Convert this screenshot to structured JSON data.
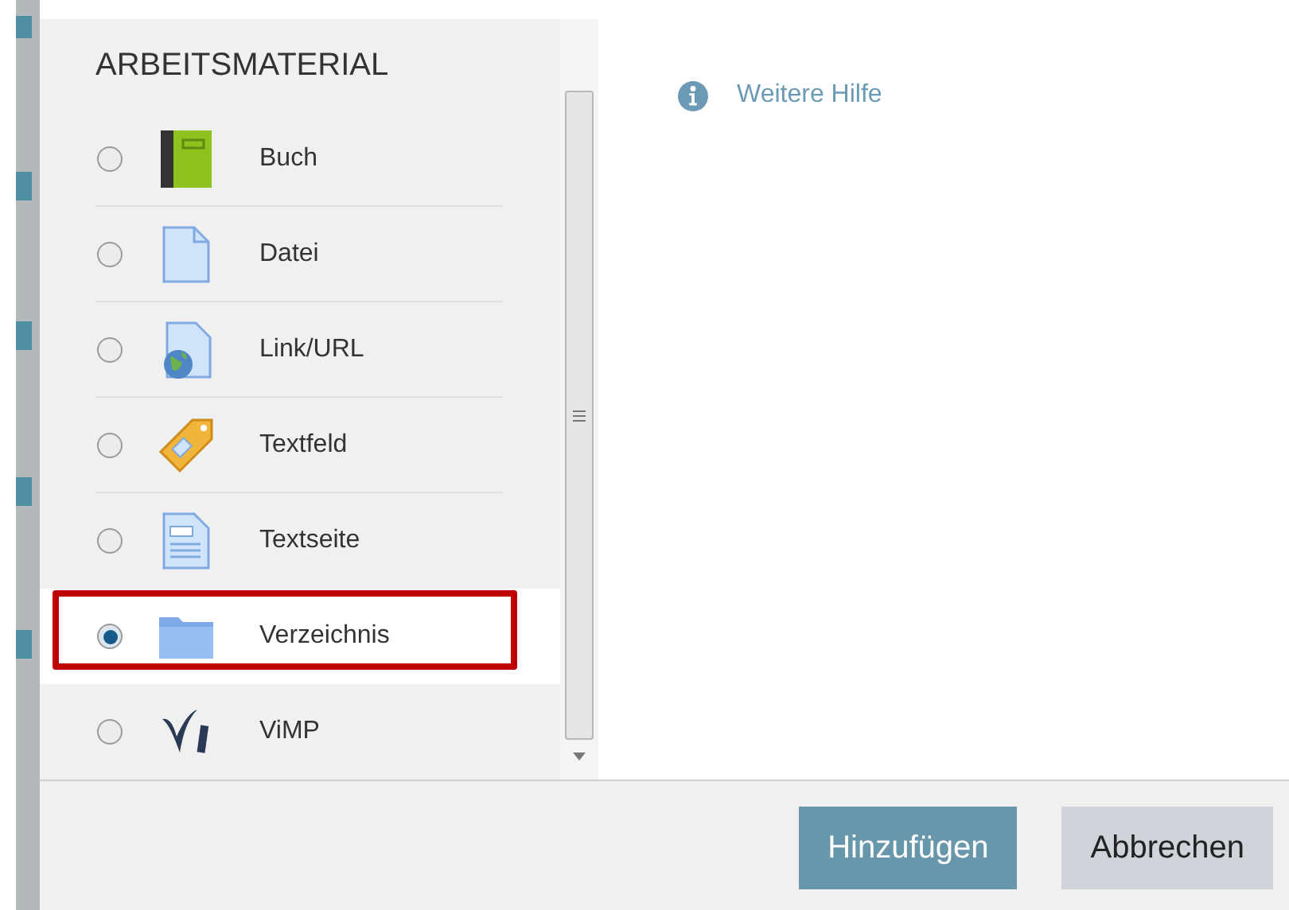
{
  "heading": "ARBEITSMATERIAL",
  "items": [
    {
      "label": "Buch",
      "kind": "book",
      "selected": false,
      "highlighted": false
    },
    {
      "label": "Datei",
      "kind": "file",
      "selected": false,
      "highlighted": false
    },
    {
      "label": "Link/URL",
      "kind": "link",
      "selected": false,
      "highlighted": false
    },
    {
      "label": "Textfeld",
      "kind": "label",
      "selected": false,
      "highlighted": false
    },
    {
      "label": "Textseite",
      "kind": "page",
      "selected": false,
      "highlighted": false
    },
    {
      "label": "Verzeichnis",
      "kind": "folder",
      "selected": true,
      "highlighted": true
    },
    {
      "label": "ViMP",
      "kind": "video",
      "selected": false,
      "highlighted": false
    }
  ],
  "help_link": "Weitere Hilfe",
  "buttons": [
    {
      "label": "Hinzufügen",
      "kind": "primary"
    },
    {
      "label": "Abbrechen",
      "kind": "secondary"
    }
  ]
}
